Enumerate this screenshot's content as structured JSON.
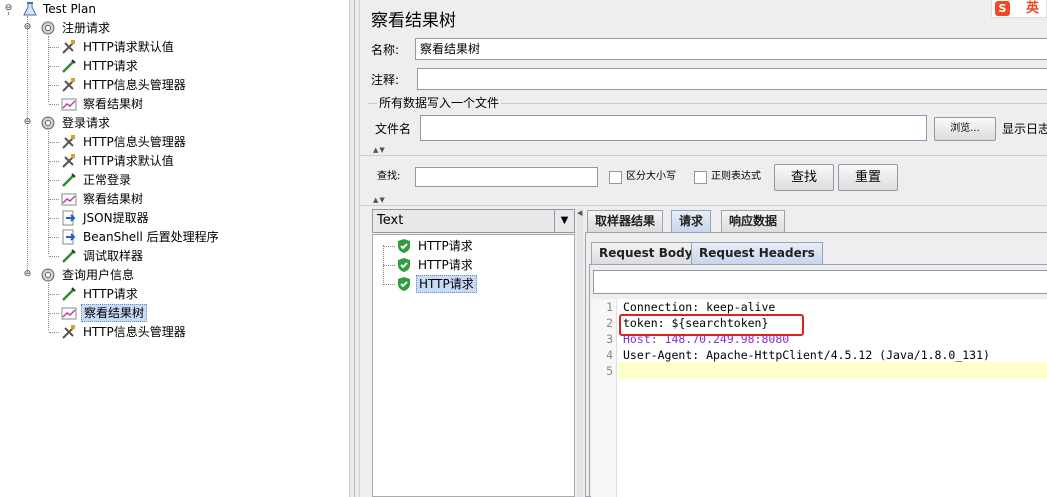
{
  "tree": {
    "root": "Test Plan",
    "groups": [
      {
        "label": "注册请求",
        "items": [
          "HTTP请求默认值",
          "HTTP请求",
          "HTTP信息头管理器",
          "察看结果树"
        ]
      },
      {
        "label": "登录请求",
        "items": [
          "HTTP信息头管理器",
          "HTTP请求默认值",
          "正常登录",
          "察看结果树",
          "JSON提取器",
          "BeanShell 后置处理程序",
          "调试取样器"
        ]
      },
      {
        "label": "查询用户信息",
        "items": [
          "HTTP请求",
          "察看结果树",
          "HTTP信息头管理器"
        ]
      }
    ]
  },
  "panel": {
    "title": "察看结果树",
    "name_label": "名称:",
    "name_value": "察看结果树",
    "comment_label": "注释:",
    "comment_value": "",
    "section_title": "所有数据写入一个文件",
    "filename_label": "文件名",
    "filename_value": "",
    "browse_label": "浏览...",
    "log_label": "显示日志"
  },
  "search": {
    "label": "查找:",
    "value": "",
    "case_label": "区分大小写",
    "regex_label": "正则表达式",
    "find_label": "查找",
    "reset_label": "重置"
  },
  "results": {
    "renderer": "Text",
    "samples": [
      "HTTP请求",
      "HTTP请求",
      "HTTP请求"
    ],
    "tabs": [
      "取样器结果",
      "请求",
      "响应数据"
    ],
    "subtabs": [
      "Request Body",
      "Request Headers"
    ],
    "lines": [
      {
        "num": "1",
        "text": "Connection: keep-alive"
      },
      {
        "num": "2",
        "text": "token: ${searchtoken}"
      },
      {
        "num": "3",
        "text": "Host: 148.70.249.98:8080"
      },
      {
        "num": "4",
        "text": "User-Agent: Apache-HttpClient/4.5.12 (Java/1.8.0_131)"
      },
      {
        "num": "5",
        "text": ""
      }
    ]
  },
  "ime_badge": "英",
  "colors": {
    "selection": "#c8daf5",
    "highlight_box": "#e02020",
    "current_line": "#ffffcc",
    "value_purple": "#8a2be2",
    "success_green": "#2e9e3e"
  }
}
